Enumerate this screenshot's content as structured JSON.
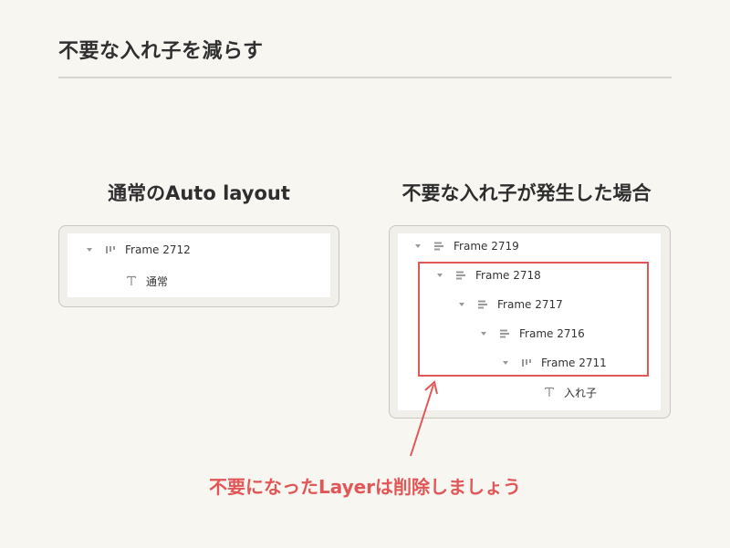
{
  "title": "不要な入れ子を減らす",
  "left": {
    "heading": "通常のAuto layout",
    "layers": [
      {
        "label": "Frame 2712",
        "icon": "auto-layout-horizontal-icon",
        "expanded": true
      },
      {
        "label": "通常",
        "icon": "text-icon",
        "expanded": false
      }
    ]
  },
  "right": {
    "heading": "不要な入れ子が発生した場合",
    "layers": [
      {
        "label": "Frame 2719",
        "icon": "auto-layout-vertical-icon",
        "expanded": true
      },
      {
        "label": "Frame 2718",
        "icon": "auto-layout-vertical-icon",
        "expanded": true
      },
      {
        "label": "Frame 2717",
        "icon": "auto-layout-vertical-icon",
        "expanded": true
      },
      {
        "label": "Frame 2716",
        "icon": "auto-layout-vertical-icon",
        "expanded": true
      },
      {
        "label": "Frame 2711",
        "icon": "auto-layout-horizontal-icon",
        "expanded": true
      },
      {
        "label": "入れ子",
        "icon": "text-icon",
        "expanded": false
      }
    ]
  },
  "callout": "不要になったLayerは削除しましょう",
  "colors": {
    "background": "#f8f6f1",
    "accent": "#e15656",
    "panel_border": "#c9c6bf",
    "text": "#2e2e2e"
  }
}
